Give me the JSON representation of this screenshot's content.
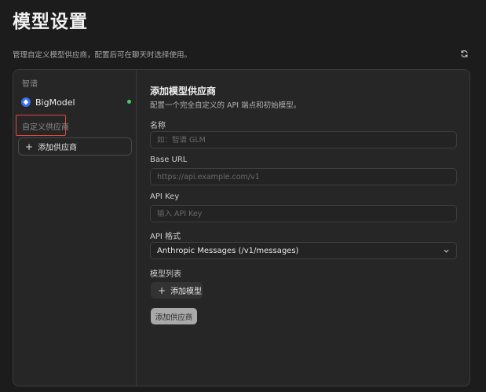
{
  "page": {
    "title": "模型设置",
    "subtitle": "管理自定义模型供应商，配置后可在聊天时选择使用。",
    "refresh_icon": "refresh-icon"
  },
  "sidebar": {
    "section_zhipu": "智谱",
    "provider": {
      "name": "BigModel",
      "status": "active",
      "status_color": "#3fcf6b",
      "logo_color": "#3a6ff0"
    },
    "section_custom": "自定义供应商",
    "add_provider_label": "添加供应商"
  },
  "form": {
    "title": "添加模型供应商",
    "description": "配置一个完全自定义的 API 端点和初始模型。",
    "name_label": "名称",
    "name_placeholder": "如：智谱 GLM",
    "base_url_label": "Base URL",
    "base_url_placeholder": "https://api.example.com/v1",
    "api_key_label": "API Key",
    "api_key_placeholder": "输入 API Key",
    "api_format_label": "API 格式",
    "api_format_value": "Anthropic Messages (/v1/messages)",
    "model_list_label": "模型列表",
    "add_model_label": "添加模型",
    "submit_label": "添加供应商"
  },
  "colors": {
    "background": "#1c1c1c",
    "panel": "#262626",
    "highlight_box": "#e0483d"
  }
}
